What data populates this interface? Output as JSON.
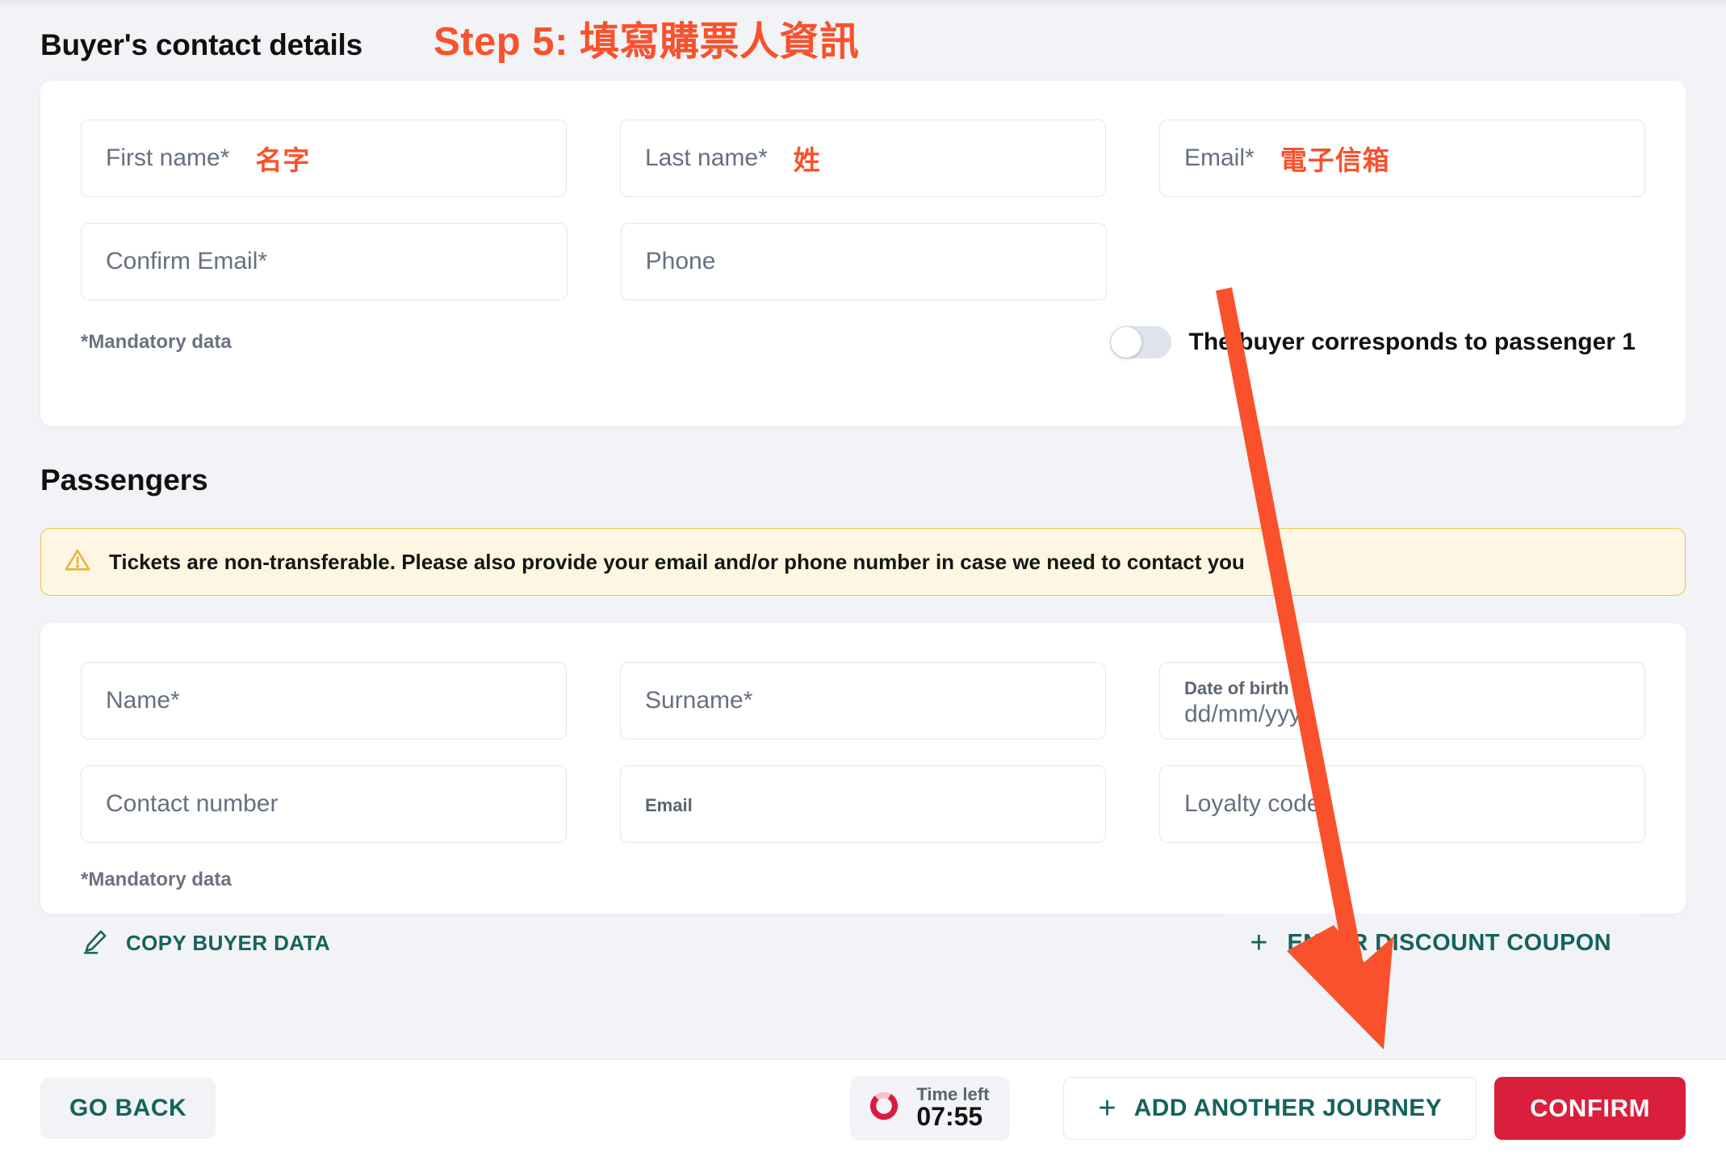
{
  "annotation": {
    "step_banner": "Step 5: 填寫購票人資訊",
    "arrow_color": "#f9512c"
  },
  "buyer": {
    "section_title": "Buyer's contact details",
    "fields": [
      {
        "placeholder": "First name*",
        "note": "名字"
      },
      {
        "placeholder": "Last name*",
        "note": "姓"
      },
      {
        "placeholder": "Email*",
        "note": "電子信箱"
      },
      {
        "placeholder": "Confirm Email*",
        "note": ""
      },
      {
        "placeholder": "Phone",
        "note": ""
      }
    ],
    "mandatory_note": "*Mandatory data",
    "toggle": {
      "label": "The buyer corresponds to passenger 1",
      "state": "off"
    }
  },
  "passengers": {
    "section_title": "Passengers",
    "warning": {
      "icon": "warning-triangle-icon",
      "text": "Tickets are non-transferable. Please also provide your email and/or phone number in case we need to contact you"
    },
    "fields": [
      {
        "placeholder": "Name*",
        "floating_label": ""
      },
      {
        "placeholder": "Surname*",
        "floating_label": ""
      },
      {
        "placeholder": "dd/mm/yyyy",
        "floating_label": "Date of birth"
      },
      {
        "placeholder": "Contact number",
        "floating_label": ""
      },
      {
        "placeholder": "",
        "floating_label": "Email"
      },
      {
        "placeholder": "Loyalty code",
        "floating_label": ""
      }
    ],
    "mandatory_note": "*Mandatory data",
    "copy_buyer_data": {
      "icon": "pencil-icon",
      "label": "COPY BUYER DATA"
    },
    "discount_coupon": {
      "icon": "plus-icon",
      "label": "ENTER DISCOUNT COUPON"
    }
  },
  "footer": {
    "go_back": "GO BACK",
    "timer": {
      "icon": "timer-ring-icon",
      "label": "Time left",
      "value": "07:55"
    },
    "add_journey": {
      "icon": "plus-icon",
      "label": "ADD ANOTHER JOURNEY"
    },
    "confirm": "CONFIRM"
  },
  "colors": {
    "accent_red": "#f9512c",
    "confirm_red": "#da1f3d",
    "teal": "#14635c",
    "warning_bg": "#fdf6e3",
    "warning_border": "#f2c14e",
    "page_bg": "#f1f3f6"
  }
}
